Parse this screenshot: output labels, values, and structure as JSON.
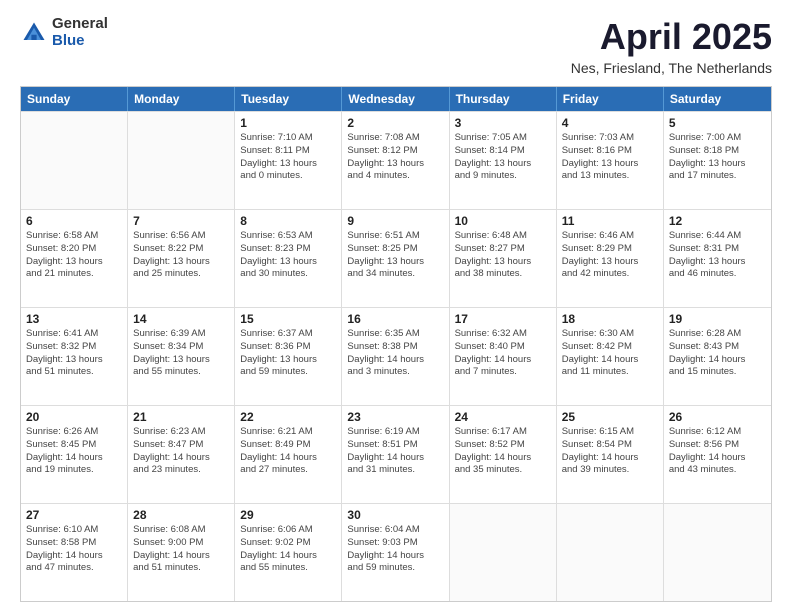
{
  "logo": {
    "general": "General",
    "blue": "Blue"
  },
  "title": {
    "month": "April 2025",
    "location": "Nes, Friesland, The Netherlands"
  },
  "header_days": [
    "Sunday",
    "Monday",
    "Tuesday",
    "Wednesday",
    "Thursday",
    "Friday",
    "Saturday"
  ],
  "weeks": [
    [
      {
        "day": "",
        "info": ""
      },
      {
        "day": "",
        "info": ""
      },
      {
        "day": "1",
        "info": "Sunrise: 7:10 AM\nSunset: 8:11 PM\nDaylight: 13 hours\nand 0 minutes."
      },
      {
        "day": "2",
        "info": "Sunrise: 7:08 AM\nSunset: 8:12 PM\nDaylight: 13 hours\nand 4 minutes."
      },
      {
        "day": "3",
        "info": "Sunrise: 7:05 AM\nSunset: 8:14 PM\nDaylight: 13 hours\nand 9 minutes."
      },
      {
        "day": "4",
        "info": "Sunrise: 7:03 AM\nSunset: 8:16 PM\nDaylight: 13 hours\nand 13 minutes."
      },
      {
        "day": "5",
        "info": "Sunrise: 7:00 AM\nSunset: 8:18 PM\nDaylight: 13 hours\nand 17 minutes."
      }
    ],
    [
      {
        "day": "6",
        "info": "Sunrise: 6:58 AM\nSunset: 8:20 PM\nDaylight: 13 hours\nand 21 minutes."
      },
      {
        "day": "7",
        "info": "Sunrise: 6:56 AM\nSunset: 8:22 PM\nDaylight: 13 hours\nand 25 minutes."
      },
      {
        "day": "8",
        "info": "Sunrise: 6:53 AM\nSunset: 8:23 PM\nDaylight: 13 hours\nand 30 minutes."
      },
      {
        "day": "9",
        "info": "Sunrise: 6:51 AM\nSunset: 8:25 PM\nDaylight: 13 hours\nand 34 minutes."
      },
      {
        "day": "10",
        "info": "Sunrise: 6:48 AM\nSunset: 8:27 PM\nDaylight: 13 hours\nand 38 minutes."
      },
      {
        "day": "11",
        "info": "Sunrise: 6:46 AM\nSunset: 8:29 PM\nDaylight: 13 hours\nand 42 minutes."
      },
      {
        "day": "12",
        "info": "Sunrise: 6:44 AM\nSunset: 8:31 PM\nDaylight: 13 hours\nand 46 minutes."
      }
    ],
    [
      {
        "day": "13",
        "info": "Sunrise: 6:41 AM\nSunset: 8:32 PM\nDaylight: 13 hours\nand 51 minutes."
      },
      {
        "day": "14",
        "info": "Sunrise: 6:39 AM\nSunset: 8:34 PM\nDaylight: 13 hours\nand 55 minutes."
      },
      {
        "day": "15",
        "info": "Sunrise: 6:37 AM\nSunset: 8:36 PM\nDaylight: 13 hours\nand 59 minutes."
      },
      {
        "day": "16",
        "info": "Sunrise: 6:35 AM\nSunset: 8:38 PM\nDaylight: 14 hours\nand 3 minutes."
      },
      {
        "day": "17",
        "info": "Sunrise: 6:32 AM\nSunset: 8:40 PM\nDaylight: 14 hours\nand 7 minutes."
      },
      {
        "day": "18",
        "info": "Sunrise: 6:30 AM\nSunset: 8:42 PM\nDaylight: 14 hours\nand 11 minutes."
      },
      {
        "day": "19",
        "info": "Sunrise: 6:28 AM\nSunset: 8:43 PM\nDaylight: 14 hours\nand 15 minutes."
      }
    ],
    [
      {
        "day": "20",
        "info": "Sunrise: 6:26 AM\nSunset: 8:45 PM\nDaylight: 14 hours\nand 19 minutes."
      },
      {
        "day": "21",
        "info": "Sunrise: 6:23 AM\nSunset: 8:47 PM\nDaylight: 14 hours\nand 23 minutes."
      },
      {
        "day": "22",
        "info": "Sunrise: 6:21 AM\nSunset: 8:49 PM\nDaylight: 14 hours\nand 27 minutes."
      },
      {
        "day": "23",
        "info": "Sunrise: 6:19 AM\nSunset: 8:51 PM\nDaylight: 14 hours\nand 31 minutes."
      },
      {
        "day": "24",
        "info": "Sunrise: 6:17 AM\nSunset: 8:52 PM\nDaylight: 14 hours\nand 35 minutes."
      },
      {
        "day": "25",
        "info": "Sunrise: 6:15 AM\nSunset: 8:54 PM\nDaylight: 14 hours\nand 39 minutes."
      },
      {
        "day": "26",
        "info": "Sunrise: 6:12 AM\nSunset: 8:56 PM\nDaylight: 14 hours\nand 43 minutes."
      }
    ],
    [
      {
        "day": "27",
        "info": "Sunrise: 6:10 AM\nSunset: 8:58 PM\nDaylight: 14 hours\nand 47 minutes."
      },
      {
        "day": "28",
        "info": "Sunrise: 6:08 AM\nSunset: 9:00 PM\nDaylight: 14 hours\nand 51 minutes."
      },
      {
        "day": "29",
        "info": "Sunrise: 6:06 AM\nSunset: 9:02 PM\nDaylight: 14 hours\nand 55 minutes."
      },
      {
        "day": "30",
        "info": "Sunrise: 6:04 AM\nSunset: 9:03 PM\nDaylight: 14 hours\nand 59 minutes."
      },
      {
        "day": "",
        "info": ""
      },
      {
        "day": "",
        "info": ""
      },
      {
        "day": "",
        "info": ""
      }
    ]
  ]
}
